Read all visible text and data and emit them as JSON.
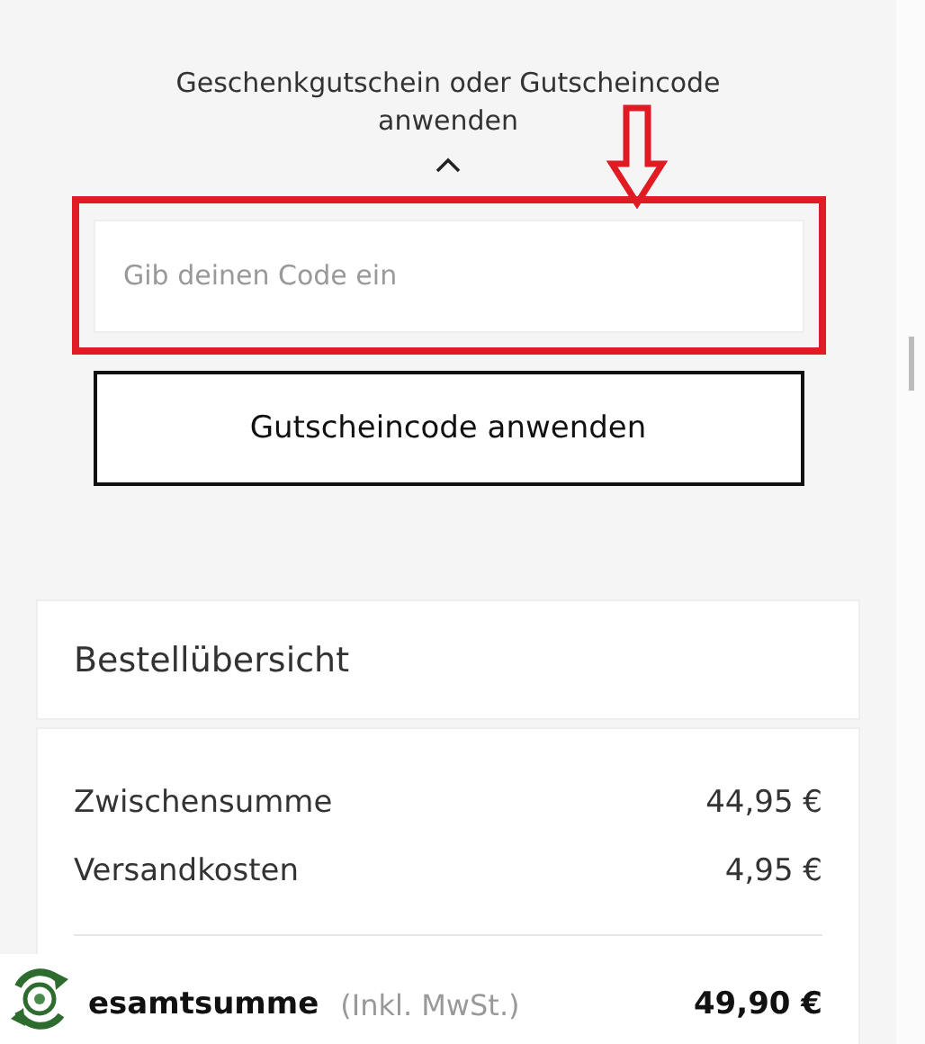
{
  "coupon": {
    "toggle_label": "Geschenkgutschein oder Gutscheincode anwenden",
    "expanded": true,
    "placeholder": "Gib deinen Code ein",
    "apply_button": "Gutscheincode anwenden"
  },
  "summary": {
    "title": "Bestellübersicht",
    "rows": [
      {
        "label": "Zwischensumme",
        "value": "44,95 €"
      },
      {
        "label": "Versandkosten",
        "value": "4,95 €"
      }
    ],
    "total": {
      "label": "esamtsumme",
      "note": "(Inkl. MwSt.)",
      "value": "49,90 €"
    }
  }
}
